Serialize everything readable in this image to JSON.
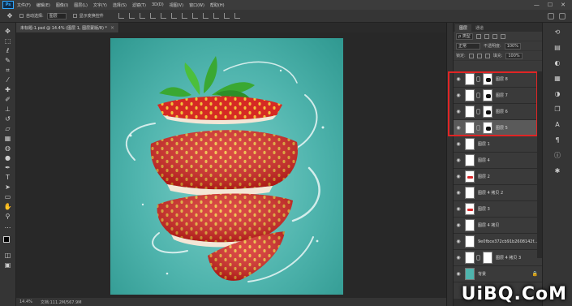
{
  "app": {
    "logo": "Ps"
  },
  "menubar": {
    "items": [
      "文件(F)",
      "编辑(E)",
      "图像(I)",
      "图层(L)",
      "文字(Y)",
      "选择(S)",
      "滤镜(T)",
      "3D(D)",
      "视图(V)",
      "窗口(W)",
      "帮助(H)"
    ],
    "controls": [
      "—",
      "☐",
      "✕"
    ]
  },
  "options": {
    "auto_select_label": "自动选择:",
    "auto_select_value": "图层",
    "transform_label": "显示变换控件"
  },
  "document_tab": {
    "title": "未标题-1.psd @ 14.4% (图层 1, 图层蒙版/8) *",
    "close": "×"
  },
  "status": {
    "zoom": "14.4%",
    "doc_size": "文档:111.2M/567.9M"
  },
  "layers_panel": {
    "tabs": [
      "图层",
      "通道"
    ],
    "kind_label": "ρ 类型",
    "blend_mode": "正常",
    "opacity_label": "不透明度:",
    "opacity_value": "100%",
    "lock_label": "锁定:",
    "fill_label": "填充:",
    "fill_value": "100%",
    "layers": [
      {
        "name": "图层 8",
        "thumb": "mask",
        "selected": false
      },
      {
        "name": "图层 7",
        "thumb": "mask",
        "selected": false
      },
      {
        "name": "图层 6",
        "thumb": "mask",
        "selected": false
      },
      {
        "name": "图层 5",
        "thumb": "mask",
        "selected": true
      },
      {
        "name": "图层 1",
        "thumb": "plain",
        "selected": false
      },
      {
        "name": "图层 4",
        "thumb": "plain",
        "selected": false
      },
      {
        "name": "图层 2",
        "thumb": "red",
        "selected": false
      },
      {
        "name": "图层 4 拷贝 2",
        "thumb": "plain",
        "selected": false
      },
      {
        "name": "图层 3",
        "thumb": "red",
        "selected": false
      },
      {
        "name": "图层 4 拷贝",
        "thumb": "plain",
        "selected": false
      },
      {
        "name": "9e0fbce372cb91b2608142f...",
        "thumb": "plain",
        "selected": false
      },
      {
        "name": "图层 4 拷贝 3",
        "thumb": "mask",
        "selected": false
      },
      {
        "name": "背景",
        "thumb": "teal",
        "selected": false,
        "locked": true
      }
    ]
  },
  "watermark": "UiBQ.CoM",
  "colors": {
    "canvas_bg": "#4fb4ad",
    "highlight": "#e02525",
    "strawberry": "#d8282a"
  }
}
